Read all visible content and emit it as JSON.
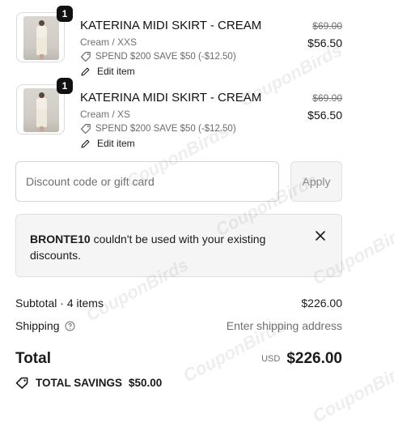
{
  "cart": {
    "items": [
      {
        "quantity": "1",
        "title": "KATERINA MIDI SKIRT - CREAM",
        "variant": "Cream / XXS",
        "discount": "SPEND $200 SAVE $50 (-$12.50)",
        "edit_label": "Edit item",
        "original_price": "$69.00",
        "price": "$56.50"
      },
      {
        "quantity": "1",
        "title": "KATERINA MIDI SKIRT - CREAM",
        "variant": "Cream / XS",
        "discount": "SPEND $200 SAVE $50 (-$12.50)",
        "edit_label": "Edit item",
        "original_price": "$69.00",
        "price": "$56.50"
      }
    ]
  },
  "discount": {
    "placeholder": "Discount code or gift card",
    "apply_label": "Apply"
  },
  "alert": {
    "code": "BRONTE10",
    "message": " couldn't be used with your existing discounts."
  },
  "summary": {
    "subtotal_label": "Subtotal · 4 items",
    "subtotal_value": "$226.00",
    "shipping_label": "Shipping",
    "shipping_value": "Enter shipping address",
    "total_label": "Total",
    "currency": "USD",
    "total_value": "$226.00",
    "savings_label": "TOTAL SAVINGS",
    "savings_value": "$50.00"
  },
  "watermark": "CouponBirds",
  "icons": {
    "tag": "tag-icon",
    "edit": "pencil-icon",
    "close": "close-icon",
    "help": "help-circle-icon",
    "savings": "tag-icon"
  }
}
